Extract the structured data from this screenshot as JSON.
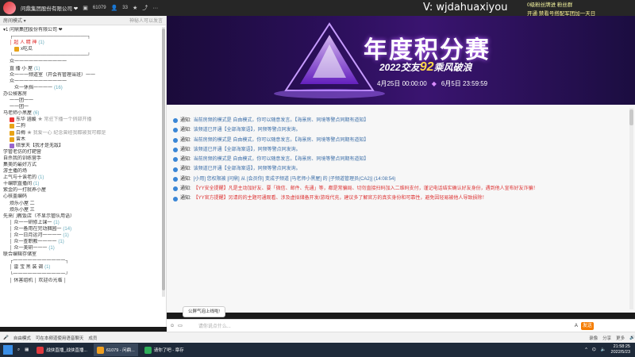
{
  "topbar": {
    "title": "问鼎集团股份有限公司 ❤",
    "id": "61079",
    "online": "33"
  },
  "promo": {
    "wechat": "V: wjdahuaxiyou",
    "right_line1": "0级粉丝牌进 粉丝群",
    "right_line2": "开通 禁看号搭配军团加一天日"
  },
  "sidebar": {
    "tab_left": "房间模式 ▾",
    "tab_right": "神秘人可以发言",
    "items": [
      {
        "indent": 0,
        "text": "▾1  问鼎集团股份有限公司  ❤",
        "badge": "",
        "count": ""
      },
      {
        "indent": 1,
        "text": "┌──────────────────────┐",
        "badge": "",
        "count": ""
      },
      {
        "indent": 1,
        "text": "│  超 人 精 神",
        "badge": "",
        "count": "(1)",
        "red": true
      },
      {
        "indent": 2,
        "text": "x吃瓜",
        "badge": "gold",
        "count": ""
      },
      {
        "indent": 1,
        "text": "└──────────────────────┘",
        "badge": "",
        "count": ""
      },
      {
        "indent": 1,
        "text": "众一一一一一一一一一一一",
        "badge": "",
        "count": ""
      },
      {
        "indent": 1,
        "text": "直 播 小 屋",
        "badge": "",
        "count": "(1)"
      },
      {
        "indent": 1,
        "text": "众一一一频道室（开会有管理当班）一一",
        "badge": "",
        "count": ""
      },
      {
        "indent": 1,
        "text": "众一一一一一一一一一一一",
        "badge": "",
        "count": ""
      },
      {
        "indent": 2,
        "text": "众一休挡一一一一",
        "badge": "",
        "count": "(16)"
      },
      {
        "indent": 0,
        "text": "办公候客房",
        "badge": "",
        "count": ""
      },
      {
        "indent": 1,
        "text": "一一团一一",
        "badge": "",
        "count": ""
      },
      {
        "indent": 1,
        "text": "一一团一",
        "badge": "",
        "count": ""
      },
      {
        "indent": 0,
        "text": "马老师小黑屋",
        "badge": "",
        "count": "(6)"
      },
      {
        "indent": 1,
        "text": "东华  涵媛",
        "badge": "red",
        "count": "",
        "muted": "★ 常驻下播一个俏部开播"
      },
      {
        "indent": 1,
        "text": "二狗",
        "badge": "gold",
        "count": ""
      },
      {
        "indent": 1,
        "text": "白梅",
        "badge": "gold",
        "count": "",
        "muted": "★ 我爱一心 纪念曾经我都被我可都是"
      },
      {
        "indent": 1,
        "text": "曾木",
        "badge": "gold",
        "count": ""
      },
      {
        "indent": 1,
        "text": "硕享天【我才是无敌】",
        "badge": "purple",
        "count": ""
      },
      {
        "indent": 0,
        "text": "学管老仿的打靶营",
        "badge": "",
        "count": ""
      },
      {
        "indent": 0,
        "text": "自杀我的训练营手",
        "badge": "",
        "count": ""
      },
      {
        "indent": 0,
        "text": "集美的最好方式",
        "badge": "",
        "count": ""
      },
      {
        "indent": 0,
        "text": "游主播的场",
        "badge": "",
        "count": ""
      },
      {
        "indent": 0,
        "text": "上气与十诶老的",
        "badge": "",
        "count": "(1)"
      },
      {
        "indent": 0,
        "text": "十编职直播间",
        "badge": "",
        "count": "(1)"
      },
      {
        "indent": 0,
        "text": "紫金的一打就养小屋",
        "badge": "",
        "count": ""
      },
      {
        "indent": 0,
        "text": "心核盖编码",
        "badge": "",
        "count": ""
      },
      {
        "indent": 1,
        "text": "烦乐小屋 二",
        "badge": "",
        "count": ""
      },
      {
        "indent": 1,
        "text": "烦乐小屋 三",
        "badge": "",
        "count": ""
      },
      {
        "indent": 0,
        "text": "先来门教饭店（不显示管队用语）",
        "badge": "",
        "count": ""
      },
      {
        "indent": 1,
        "text": "│    众一一研修上课一",
        "badge": "",
        "count": "(1)"
      },
      {
        "indent": 1,
        "text": "│    众一备用在完动捆园一",
        "badge": "",
        "count": "(14)"
      },
      {
        "indent": 1,
        "text": "│    众一日月运河一一一一",
        "badge": "",
        "count": "(1)"
      },
      {
        "indent": 1,
        "text": "│    众一查职教一一一一",
        "badge": "",
        "count": "(1)"
      },
      {
        "indent": 1,
        "text": "│    众一美研一一一",
        "badge": "",
        "count": "(1)"
      },
      {
        "indent": 0,
        "text": "联合编辑存储室",
        "badge": "",
        "count": ""
      },
      {
        "indent": 1,
        "text": "┌一一一一一一一一一一一┐",
        "badge": "",
        "count": ""
      },
      {
        "indent": 1,
        "text": "│    雷 宝 黑 装 调",
        "badge": "",
        "count": "(1)"
      },
      {
        "indent": 1,
        "text": "└一一一一一一一一一一一┘",
        "badge": "",
        "count": ""
      },
      {
        "indent": 1,
        "text": "│    休害组机          │ 欢迎の光临 │",
        "badge": "",
        "count": ""
      }
    ]
  },
  "banner": {
    "title": "年度积分赛",
    "sub_prefix": "2022交友",
    "sub_num": "92",
    "sub_suffix": "乘风破浪",
    "date_start": "4月25日 00:00:00",
    "date_end": "6月5日 23:59:59"
  },
  "chat": {
    "messages": [
      {
        "label": "通知:",
        "text": "当前房频的模式是 自由模式，你可以随意发言。【海景房、同境等警点同期有道知】",
        "red": false
      },
      {
        "label": "通知:",
        "text": "该频道已开通【全部海案语】，同频等警点同发询。",
        "red": false
      },
      {
        "label": "通知:",
        "text": "当前房频的模式是 自由模式，你可以随意发言。【海景房、同境等警点同期有道知】",
        "red": false
      },
      {
        "label": "通知:",
        "text": "该频道已开通【全部海案语】，同频等警点同发询。",
        "red": false
      },
      {
        "label": "通知:",
        "text": "当前房频的模式是 自由模式，你可以随意发言。【海景房、同境等警点同期有道知】",
        "red": false
      },
      {
        "label": "通知:",
        "text": "该频道已开通【全部海案语】，同频等警点同发询。",
        "red": false
      },
      {
        "label": "通知:",
        "text": "[小用] 您权限被 [问鼎] 从 [会员你] 变成子频道 [马老师小黑屋] 的 [子频道管理员(CA2)]  (14:08:54)",
        "red": false
      },
      {
        "label": "通知:",
        "text": "【YY安全提醒】凡是主动加好友、要「微信、邮件、先通」等，都是常骗局、切勿直接扫码加入二维码支付，谨记电话结实确认好友身份，遇到他人宣布好友诈骗！",
        "red": true
      },
      {
        "label": "通知:",
        "text": "【YY官方提醒】另请的的主题可通观看、涉及虚拟储备开发/游戏代充，建议多了解官方的真实身份和可靠性，避免因轻易被他人导致损除！",
        "red": true
      }
    ]
  },
  "bottom": {
    "tooltip": "公屏气泡上线啦!",
    "input_placeholder": "请你说点什么...",
    "send": "发送",
    "mode": "自由模式",
    "mic_hint": "可在本频道使用语音聊天",
    "members": "成员",
    "queue": "更多",
    "record": "录像",
    "share": "分享"
  },
  "taskbar": {
    "apps": [
      {
        "label": "战侠直播_战侠直播...",
        "color": "#e0393e"
      },
      {
        "label": "61079 - 问鼎...",
        "color": "#f0a020",
        "active": true
      },
      {
        "label": "请你了吧 - 章存",
        "color": "#2fae5a"
      }
    ],
    "time": "21:58:25",
    "date": "2022/5/23"
  },
  "colors": {
    "accent": "#f57c00",
    "banner_bg": "#2b0f5a",
    "notice_blue": "#3b6ea8",
    "notice_red": "#d33333"
  }
}
